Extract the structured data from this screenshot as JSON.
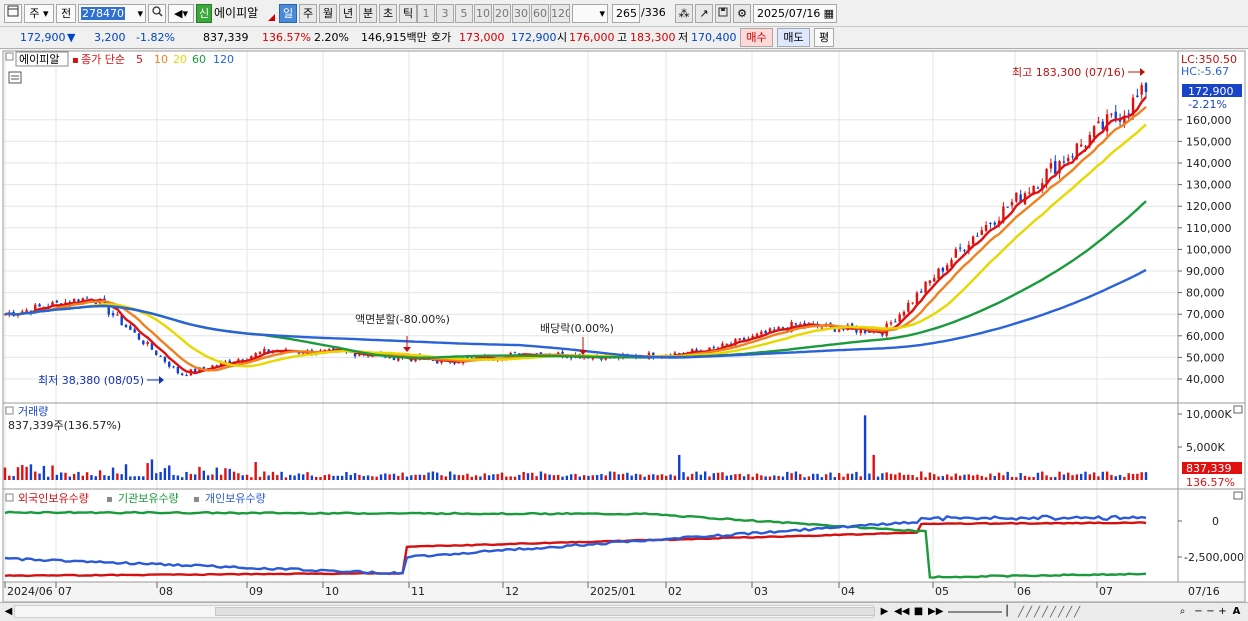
{
  "toolbar": {
    "menu_icon": "window-icon",
    "market_type": "주",
    "compare_label": "전",
    "stock_code": "278470",
    "badge_new": "신",
    "stock_name": "에이피알",
    "periods": [
      "일",
      "주",
      "월",
      "년",
      "분",
      "초",
      "틱"
    ],
    "active_period": "일",
    "minute_options": [
      "1",
      "3",
      "5",
      "10",
      "20",
      "30",
      "60",
      "120"
    ],
    "count_current": "265",
    "count_total": "/336",
    "date": "2025/07/16"
  },
  "quote": {
    "price": "172,900",
    "change": "3,200",
    "change_pct": "-1.82%",
    "volume": "837,339",
    "volume_ratio": "136.57%",
    "turnover": "2.20%",
    "amount": "146,915백만",
    "hoga_label": "호가",
    "ask": "173,000",
    "bid": "172,900",
    "open_label": "시",
    "open": "176,000",
    "high_label": "고",
    "high": "183,300",
    "low_label": "저",
    "low": "170,400",
    "buy_label": "매수",
    "sell_label": "매도",
    "eval_label": "평"
  },
  "chart_data": [
    {
      "type": "candlestick",
      "panel": "price",
      "legend": {
        "stock": "에이피알",
        "series_label": "종가 단순",
        "ma": [
          {
            "period": "5",
            "color": "#e01010"
          },
          {
            "period": "10",
            "color": "#f08020"
          },
          {
            "period": "20",
            "color": "#e8d800"
          },
          {
            "period": "60",
            "color": "#1a9a3a"
          },
          {
            "period": "120",
            "color": "#2a62d8"
          }
        ]
      },
      "y_ticks": [
        "160,000",
        "150,000",
        "140,000",
        "130,000",
        "120,000",
        "110,000",
        "100,000",
        "90,000",
        "80,000",
        "70,000",
        "60,000",
        "50,000",
        "40,000"
      ],
      "ylim": [
        30000,
        185000
      ],
      "lc_label": "LC:350.50",
      "hc_label": "HC:-5.67",
      "price_tag": "172,900",
      "price_tag_pct": "-2.21%",
      "annotations": {
        "high": "최고 183,300 (07/16)",
        "low": "최저 38,380 (08/05)",
        "split": "액면분할(-80.00%)",
        "dividend": "배당락(0.00%)"
      },
      "close": [
        {
          "date": "2024-06",
          "close": 70000
        },
        {
          "date": "2024-07",
          "close": 78000
        },
        {
          "date": "2024-08",
          "close": 42000
        },
        {
          "date": "2024-09",
          "close": 53000
        },
        {
          "date": "2024-10",
          "close": 52000
        },
        {
          "date": "2024-11",
          "close": 48000
        },
        {
          "date": "2024-12",
          "close": 52000
        },
        {
          "date": "2025-01",
          "close": 50000
        },
        {
          "date": "2025-02",
          "close": 53000
        },
        {
          "date": "2025-03",
          "close": 65000
        },
        {
          "date": "2025-04",
          "close": 62000
        },
        {
          "date": "2025-05",
          "close": 105000
        },
        {
          "date": "2025-06",
          "close": 140000
        },
        {
          "date": "2025-07",
          "close": 172900
        }
      ]
    },
    {
      "type": "bar",
      "panel": "volume",
      "title": "거래량",
      "subtitle": "837,339주(136.57%)",
      "y_ticks": [
        "10,000K",
        "5,000K"
      ],
      "ylim": [
        0,
        11000000
      ],
      "tag": "837,339",
      "tag_pct": "136.57%",
      "peaks": [
        {
          "date": "2025-03",
          "value": 3800000
        },
        {
          "date": "2025-04-29",
          "value": 9800000
        },
        {
          "date": "2025-05",
          "value": 3800000
        }
      ]
    },
    {
      "type": "line",
      "panel": "holdings",
      "series": [
        {
          "name": "외국인보유수량",
          "color": "#d41010"
        },
        {
          "name": "기관보유수량",
          "color": "#1a9a3a"
        },
        {
          "name": "개인보유수량",
          "color": "#2a5ad8"
        }
      ],
      "y_ticks": [
        "0",
        "-2,500,000"
      ]
    }
  ],
  "x_axis": {
    "labels": [
      "2024/06",
      "07",
      "08",
      "09",
      "10",
      "11",
      "12",
      "2025/01",
      "02",
      "03",
      "04",
      "05",
      "06",
      "07"
    ],
    "last_date": "07/16"
  },
  "colors": {
    "up": "#e01010",
    "down": "#1040d0",
    "grid": "#e4e4e4"
  }
}
